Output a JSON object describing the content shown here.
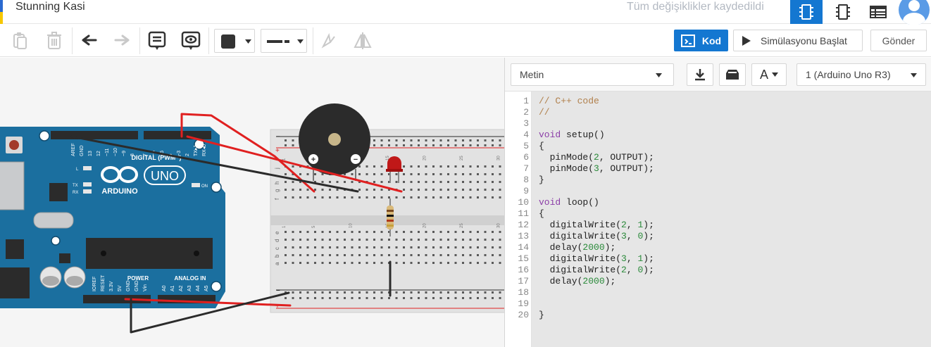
{
  "header": {
    "project_title": "Stunning Kasi",
    "save_status": "Tüm değişiklikler kaydedildi",
    "view_buttons": [
      "circuit-view-icon",
      "schematic-view-icon",
      "component-list-icon"
    ]
  },
  "toolbar": {
    "kod_label": "Kod",
    "simulate_label": "Simülasyonu Başlat",
    "send_label": "Gönder",
    "fill_color": "#333333"
  },
  "code_panel": {
    "mode_label": "Metin",
    "device_label": "1 (Arduino Uno R3)",
    "font_button": "A",
    "line_numbers": [
      "1",
      "2",
      "3",
      "4",
      "5",
      "6",
      "7",
      "8",
      "9",
      "10",
      "11",
      "12",
      "13",
      "14",
      "15",
      "16",
      "17",
      "18",
      "19",
      "20"
    ],
    "lines": [
      "// C++ code",
      "//",
      "",
      "void setup()",
      "{",
      "  pinMode(2, OUTPUT);",
      "  pinMode(3, OUTPUT);",
      "}",
      "",
      "void loop()",
      "{",
      "  digitalWrite(2, 1);",
      "  digitalWrite(3, 0);",
      "  delay(2000);",
      "  digitalWrite(3, 1);",
      "  digitalWrite(2, 0);",
      "  delay(2000);",
      "",
      "",
      "}"
    ]
  },
  "board": {
    "name": "UNO",
    "brand": "ARDUINO",
    "header_digital": "DIGITAL (PWM~)",
    "header_power": "POWER",
    "header_analog": "ANALOG IN",
    "pins_top": [
      "AREF",
      "GND",
      "13",
      "12",
      "~11",
      "~10",
      "~9",
      "8",
      "7",
      "~6",
      "~5",
      "4",
      "~3",
      "2",
      "TX▸1",
      "RX◂0"
    ],
    "pins_power": [
      "IOREF",
      "RESET",
      "3.3V",
      "5V",
      "GND",
      "GND",
      "Vin"
    ],
    "pins_analog": [
      "A0",
      "A1",
      "A2",
      "A3",
      "A4",
      "A5"
    ],
    "led_labels": [
      "L",
      "TX",
      "RX",
      "ON"
    ]
  },
  "breadboard": {
    "row_letters_top": [
      "j",
      "i",
      "h",
      "g",
      "f"
    ],
    "row_letters_bottom": [
      "e",
      "d",
      "c",
      "b",
      "a"
    ],
    "columns": [
      "1",
      "5",
      "10",
      "15",
      "20",
      "25",
      "30"
    ],
    "rail_minus": "−",
    "rail_plus": "+"
  },
  "colors": {
    "accent": "#1477d1",
    "board": "#1b6f9f",
    "wire_red": "#e02020",
    "wire_black": "#2b2b2b",
    "led_red": "#c01818"
  }
}
